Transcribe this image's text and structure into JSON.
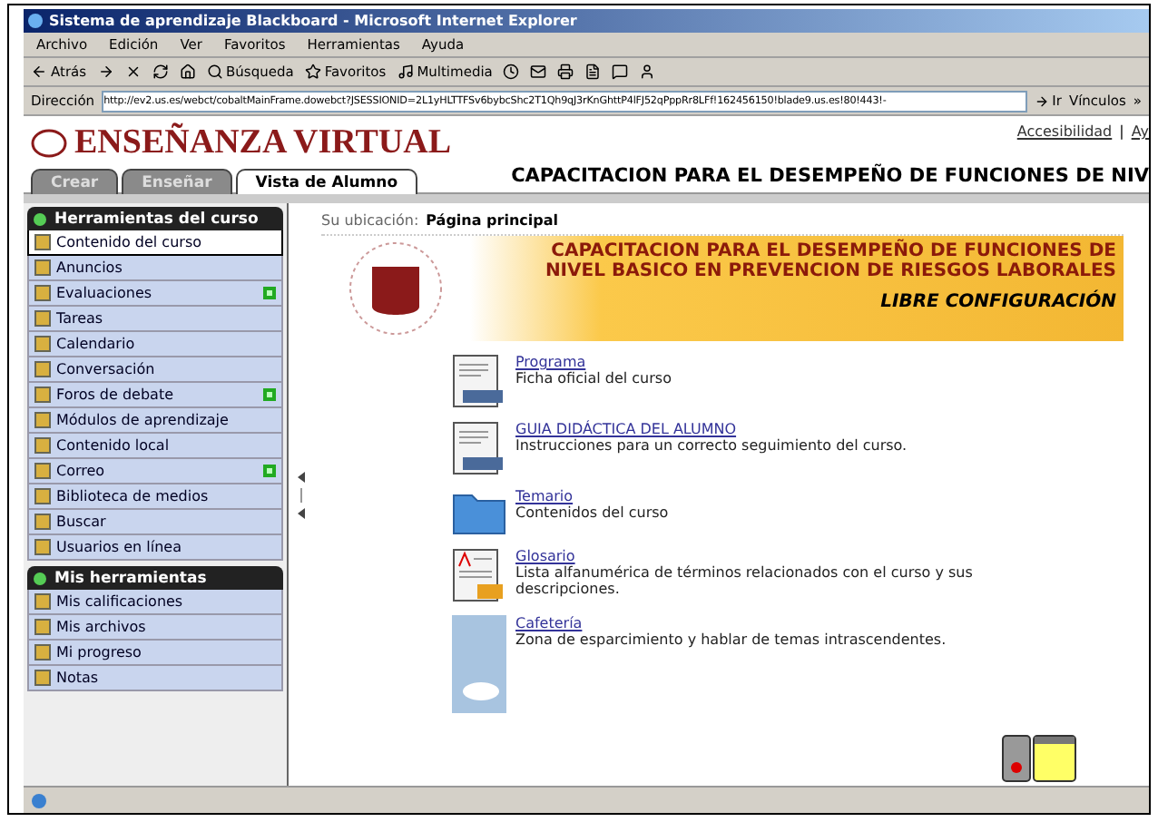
{
  "window": {
    "title": "Sistema de aprendizaje Blackboard - Microsoft Internet Explorer"
  },
  "menu": [
    "Archivo",
    "Edición",
    "Ver",
    "Favoritos",
    "Herramientas",
    "Ayuda"
  ],
  "toolbar": [
    {
      "kind": "back",
      "label": "Atrás"
    },
    {
      "kind": "forward"
    },
    {
      "kind": "stop"
    },
    {
      "kind": "refresh"
    },
    {
      "kind": "home"
    },
    {
      "kind": "search",
      "label": "Búsqueda"
    },
    {
      "kind": "favorites",
      "label": "Favoritos"
    },
    {
      "kind": "media",
      "label": "Multimedia"
    },
    {
      "kind": "history"
    },
    {
      "kind": "mail"
    },
    {
      "kind": "print"
    },
    {
      "kind": "edit"
    },
    {
      "kind": "discuss"
    },
    {
      "kind": "messenger"
    }
  ],
  "address": {
    "label": "Dirección",
    "url": "http://ev2.us.es/webct/cobaltMainFrame.dowebct?JSESSIONID=2L1yHLTTFSv6bybcShc2T1Qh9qJ3rKnGhttP4lFJ52qPppRr8LFf!162456150!blade9.us.es!80!443!-",
    "go": "Ir",
    "links": "Vínculos",
    "more": "»"
  },
  "header": {
    "logo": "ENSEÑANZA VIRTUAL",
    "links": [
      "Accesibilidad",
      "Ay"
    ],
    "separator": "|",
    "course_title": "CAPACITACION PARA EL DESEMPEÑO DE FUNCIONES DE NIV",
    "tabs": [
      {
        "label": "Crear",
        "selected": false
      },
      {
        "label": "Enseñar",
        "selected": false
      },
      {
        "label": "Vista de Alumno",
        "selected": true
      }
    ]
  },
  "sidebar": [
    {
      "title": "Herramientas del curso",
      "items": [
        {
          "label": "Contenido del curso",
          "selected": true,
          "new": false
        },
        {
          "label": "Anuncios",
          "selected": false,
          "new": false
        },
        {
          "label": "Evaluaciones",
          "selected": false,
          "new": true
        },
        {
          "label": "Tareas",
          "selected": false,
          "new": false
        },
        {
          "label": "Calendario",
          "selected": false,
          "new": false
        },
        {
          "label": "Conversación",
          "selected": false,
          "new": false
        },
        {
          "label": "Foros de debate",
          "selected": false,
          "new": true
        },
        {
          "label": "Módulos de aprendizaje",
          "selected": false,
          "new": false
        },
        {
          "label": "Contenido local",
          "selected": false,
          "new": false
        },
        {
          "label": "Correo",
          "selected": false,
          "new": true
        },
        {
          "label": "Biblioteca de medios",
          "selected": false,
          "new": false
        },
        {
          "label": "Buscar",
          "selected": false,
          "new": false
        },
        {
          "label": "Usuarios en línea",
          "selected": false,
          "new": false
        }
      ]
    },
    {
      "title": "Mis herramientas",
      "items": [
        {
          "label": "Mis calificaciones",
          "selected": false,
          "new": false
        },
        {
          "label": "Mis archivos",
          "selected": false,
          "new": false
        },
        {
          "label": "Mi progreso",
          "selected": false,
          "new": false
        },
        {
          "label": "Notas",
          "selected": false,
          "new": false
        }
      ]
    }
  ],
  "location": {
    "label": "Su ubicación:",
    "value": "Página principal"
  },
  "banner": {
    "lines": [
      "CAPACITACION PARA EL DESEMPEÑO DE FUNCIONES DE",
      "NIVEL BASICO EN PREVENCION DE RIESGOS LABORALES"
    ],
    "subtitle": "LIBRE CONFIGURACIÓN"
  },
  "items": [
    {
      "kind": "html",
      "title": "Programa",
      "description": "Ficha oficial del curso"
    },
    {
      "kind": "html",
      "title": "GUIA DIDÁCTICA DEL ALUMNO",
      "description": "Instrucciones para un correcto seguimiento del curso."
    },
    {
      "kind": "folder",
      "title": "Temario",
      "description": "Contenidos del curso"
    },
    {
      "kind": "glossary",
      "title": "Glosario",
      "description": "Lista alfanumérica de términos relacionados con el curso y sus descripciones."
    },
    {
      "kind": "photo",
      "title": "Cafetería",
      "description": "Zona de esparcimiento y hablar de temas intrascendentes."
    }
  ]
}
